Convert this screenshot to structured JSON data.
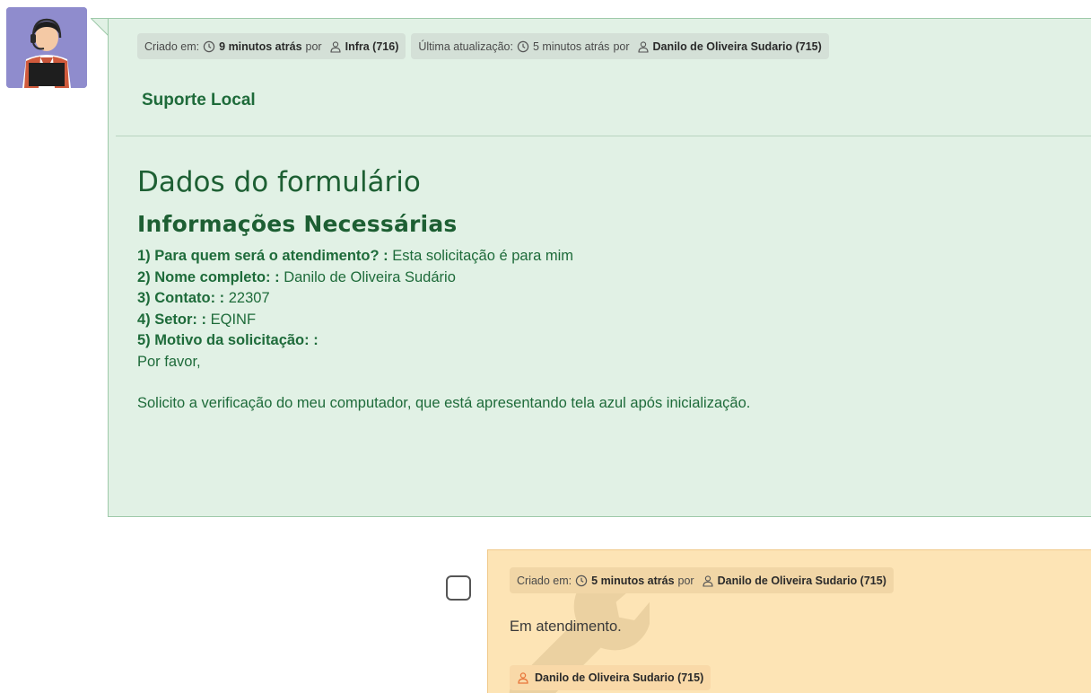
{
  "ticket": {
    "meta": {
      "created_label": "Criado em:",
      "created_time": "9 minutos atrás",
      "by_label": "por",
      "created_by": "Infra (716)",
      "updated_label": "Última atualização:",
      "updated_time": "5 minutos atrás",
      "updated_by_label": "por",
      "updated_by": "Danilo de Oliveira Sudario (715)"
    },
    "category": "Suporte Local",
    "form_title": "Dados do formulário",
    "section_title": "Informações Necessárias",
    "fields": [
      {
        "label": "1) Para quem será o atendimento? :",
        "value": " Esta solicitação é para mim"
      },
      {
        "label": "2) Nome completo: :",
        "value": " Danilo de Oliveira Sudário"
      },
      {
        "label": "3) Contato: :",
        "value": " 22307"
      },
      {
        "label": "4) Setor: :",
        "value": " EQINF"
      },
      {
        "label": "5) Motivo da solicitação: :",
        "value": ""
      }
    ],
    "body_line1": "Por favor,",
    "body_line2": "Solicito a verificação do meu computador, que está apresentando tela azul após inicialização."
  },
  "followup": {
    "meta": {
      "created_label": "Criado em:",
      "created_time": "5 minutos atrás",
      "by_label": "por",
      "created_by": "Danilo de Oliveira Sudario (715)"
    },
    "text": "Em atendimento.",
    "assignee": "Danilo de Oliveira Sudario (715)"
  },
  "colors": {
    "ticket_bg": "#e1f1e5",
    "followup_bg": "#fde4b5",
    "heading_green": "#1d5f33",
    "avatar_bg": "#8f8ccd",
    "user_icon_orange": "#e8763a"
  },
  "icons": [
    "avatar-support-agent",
    "clock-icon",
    "user-icon",
    "wrench-watermark-icon"
  ]
}
